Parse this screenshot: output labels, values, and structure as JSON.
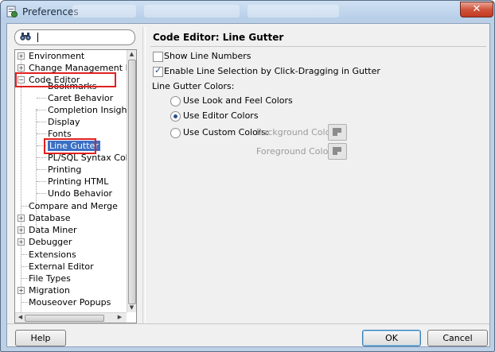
{
  "window": {
    "title": "Preferences"
  },
  "search": {
    "value": ""
  },
  "tree": {
    "items": [
      {
        "label": "Environment",
        "expander": "+"
      },
      {
        "label": "Change Management Paran",
        "expander": "+"
      },
      {
        "label": "Code Editor",
        "expander": "−"
      },
      {
        "label": "Bookmarks"
      },
      {
        "label": "Caret Behavior"
      },
      {
        "label": "Completion Insight"
      },
      {
        "label": "Display"
      },
      {
        "label": "Fonts"
      },
      {
        "label": "Line Gutter",
        "selected": true
      },
      {
        "label": "PL/SQL Syntax Colors"
      },
      {
        "label": "Printing"
      },
      {
        "label": "Printing HTML"
      },
      {
        "label": "Undo Behavior"
      },
      {
        "label": "Compare and Merge"
      },
      {
        "label": "Database",
        "expander": "+"
      },
      {
        "label": "Data Miner",
        "expander": "+"
      },
      {
        "label": "Debugger",
        "expander": "+"
      },
      {
        "label": "Extensions"
      },
      {
        "label": "External Editor"
      },
      {
        "label": "File Types"
      },
      {
        "label": "Migration",
        "expander": "+"
      },
      {
        "label": "Mouseover Popups"
      }
    ]
  },
  "panel": {
    "title": "Code Editor: Line Gutter",
    "show_line_numbers": "Show Line Numbers",
    "enable_line_selection": "Enable Line Selection by Click-Dragging in Gutter",
    "gutter_colors_label": "Line Gutter Colors:",
    "radio_look_feel": "Use Look and Feel Colors",
    "radio_editor": "Use Editor Colors",
    "radio_custom": "Use Custom Colors:",
    "background_color": "Background Color:",
    "foreground_color": "Foreground Color:"
  },
  "buttons": {
    "help": "Help",
    "ok": "OK",
    "cancel": "Cancel"
  },
  "icons": {
    "app": "preferences-app-icon",
    "close": "close-icon",
    "search": "binoculars-icon",
    "color_picker": "color-swatch-icon",
    "expand": "expand-plus-icon",
    "collapse": "collapse-minus-icon"
  },
  "colors": {
    "selection": "#3a6fc4",
    "highlight_box": "#e02020",
    "close_button": "#c13a21"
  }
}
